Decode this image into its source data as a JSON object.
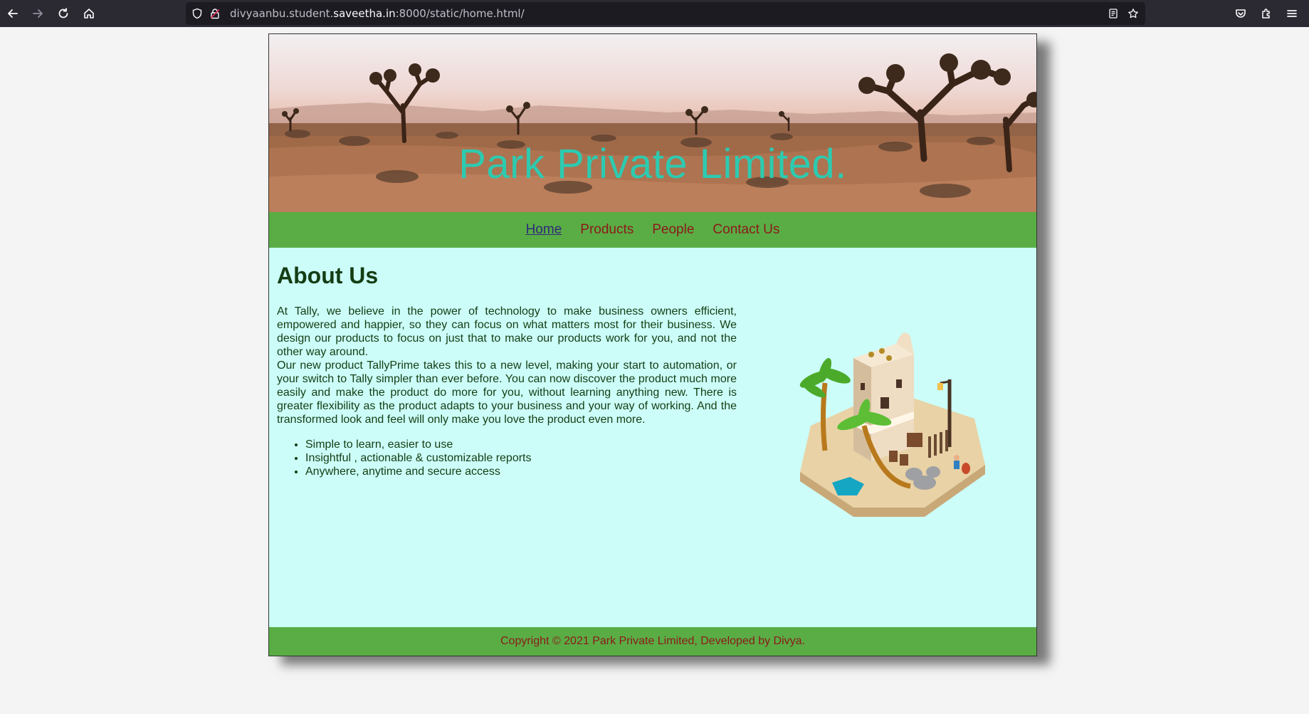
{
  "browser": {
    "url_prefix": "divyaanbu.student.",
    "url_domain": "saveetha.in",
    "url_suffix": ":8000/static/home.html/",
    "icons": [
      "back-icon",
      "forward-icon",
      "reload-icon",
      "home-icon",
      "shield-icon",
      "lock-icon",
      "reader-icon",
      "star-icon",
      "pocket-icon",
      "extensions-icon",
      "menu-icon"
    ]
  },
  "banner": {
    "title": "Park Private Limited."
  },
  "nav": {
    "items": [
      {
        "label": "Home"
      },
      {
        "label": "Products"
      },
      {
        "label": "People"
      },
      {
        "label": "Contact Us"
      }
    ]
  },
  "main": {
    "heading": "About Us",
    "paragraph1": "At Tally, we believe in the power of technology to make business owners efficient, empowered and happier, so they can focus on what matters most for their business. We design our products to focus on just that to make our products work for you, and not the other way around.",
    "paragraph2": "Our new product TallyPrime takes this to a new level, making your start to automation, or your switch to Tally simpler than ever before. You can now discover the product much more easily and make the product do more for you, without learning anything new. There is greater flexibility as the product adapts to your business and your way of working. And the transformed look and feel will only make you love the product even more.",
    "features": [
      "Simple to learn, easier to use",
      "Insightful , actionable & customizable reports",
      "Anywhere, anytime and secure access"
    ]
  },
  "footer": {
    "text": "Copyright © 2021 Park Private Limited, Developed by Divya."
  },
  "colors": {
    "nav_bg": "#5aad45",
    "content_bg": "#ccfdf8",
    "title_color": "#2dcab0",
    "link_color": "#8b1a1a"
  }
}
